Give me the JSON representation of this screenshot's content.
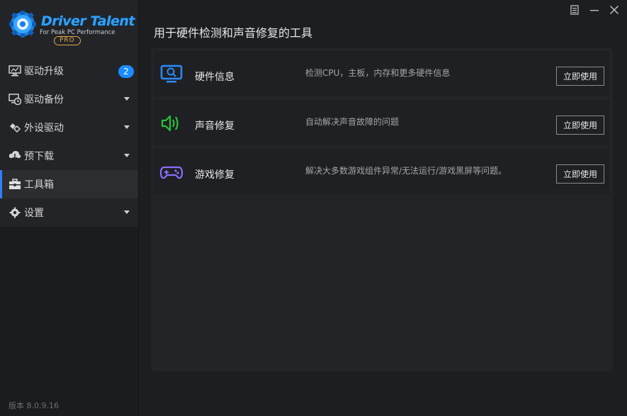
{
  "app": {
    "logo_title": "Driver Talent",
    "logo_subtitle": "For Peak PC Performance",
    "logo_badge": "PRO",
    "version": "版本 8.0.9.16"
  },
  "sidebar": {
    "items": [
      {
        "label": "驱动升级",
        "icon": "monitor-icon",
        "badge": "2"
      },
      {
        "label": "驱动备份",
        "icon": "backup-icon"
      },
      {
        "label": "外设驱动",
        "icon": "peripheral-icon"
      },
      {
        "label": "预下载",
        "icon": "cloud-download-icon"
      },
      {
        "label": "工具箱",
        "icon": "toolbox-icon",
        "active": true
      },
      {
        "label": "设置",
        "icon": "gear-icon"
      }
    ]
  },
  "main": {
    "title": "用于硬件检测和声音修复的工具",
    "tools": [
      {
        "name": "硬件信息",
        "desc": "检测CPU，主板，内存和更多硬件信息",
        "button": "立即使用",
        "icon": "hardware-monitor-icon",
        "color": "#2a8cff"
      },
      {
        "name": "声音修复",
        "desc": "自动解决声音故障的问题",
        "button": "立即使用",
        "icon": "speaker-icon",
        "color": "#27c43a"
      },
      {
        "name": "游戏修复",
        "desc": "解决大多数游戏组件异常/无法运行/游戏黑屏等问题。",
        "button": "立即使用",
        "icon": "gamepad-icon",
        "color": "#8a6cff"
      }
    ]
  },
  "colors": {
    "accent": "#2e7fff",
    "background": "#1d1e20",
    "sidebar": "#232427"
  }
}
